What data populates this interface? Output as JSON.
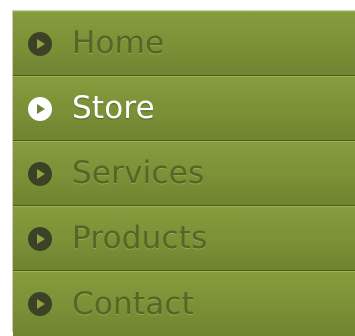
{
  "menu": {
    "items": [
      {
        "label": "Home",
        "icon": "play-bullet-icon",
        "active": false
      },
      {
        "label": "Store",
        "icon": "play-bullet-icon",
        "active": true
      },
      {
        "label": "Services",
        "icon": "play-bullet-icon",
        "active": false
      },
      {
        "label": "Products",
        "icon": "play-bullet-icon",
        "active": false
      },
      {
        "label": "Contact",
        "icon": "play-bullet-icon",
        "active": false
      }
    ]
  },
  "colors": {
    "menu_background": "#7b9037",
    "label_text": "#556628",
    "active_label_text": "#ffffff",
    "bullet_dark": "#3d4227",
    "bullet_active": "#ffffff"
  }
}
